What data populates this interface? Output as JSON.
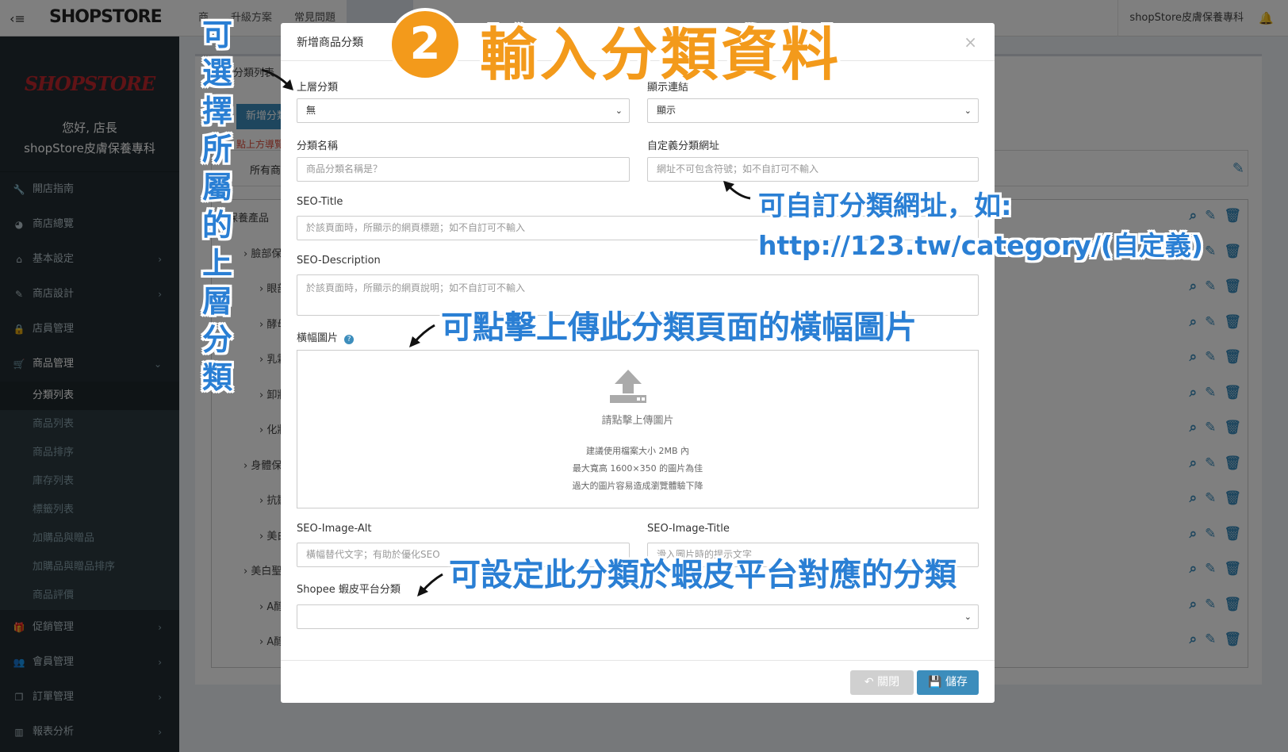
{
  "topbar": {
    "logo": "SHOPSTORE",
    "nav": [
      "商",
      "升級方案",
      "常見問題"
    ],
    "store_name": "shopStore皮膚保養專科"
  },
  "sidebar": {
    "brand": "SHOPSTORE",
    "hello": "您好, 店長",
    "store": "shopStore皮膚保養專科",
    "menu": [
      {
        "label": "開店指南",
        "icon": "wrench-icon"
      },
      {
        "label": "商店總覽",
        "icon": "dashboard-icon"
      },
      {
        "label": "基本設定",
        "icon": "bank-icon"
      },
      {
        "label": "商店設計",
        "icon": "magic-icon"
      },
      {
        "label": "店員管理",
        "icon": "lock-icon"
      },
      {
        "label": "商品管理",
        "icon": "cart-icon"
      }
    ],
    "submenu": [
      "分類列表",
      "商品列表",
      "商品排序",
      "庫存列表",
      "標籤列表",
      "加購品與贈品",
      "加購品與贈品排序",
      "商品評價"
    ],
    "menu2": [
      {
        "label": "促銷管理",
        "icon": "gift-icon"
      },
      {
        "label": "會員管理",
        "icon": "users-icon"
      },
      {
        "label": "訂單管理",
        "icon": "copy-icon"
      },
      {
        "label": "報表分析",
        "icon": "chart-icon"
      }
    ]
  },
  "content": {
    "title": "分類列表",
    "add_btn": "新增分類",
    "tip": "點上方導覽",
    "all_products": "所有商品",
    "rows": [
      "保養產品",
      "臉部保養",
      "眼部保",
      "酵母淨",
      "乳霜",
      "卸妝水",
      "化妝水",
      "身體保養",
      "抗皺身",
      "美白乳",
      "美白聖品",
      "A醇精",
      "A醇面"
    ]
  },
  "modal": {
    "title": "新增商品分類",
    "parent_label": "上層分類",
    "parent_value": "無",
    "display_label": "顯示連結",
    "display_value": "顯示",
    "name_label": "分類名稱",
    "name_placeholder": "商品分類名稱是？",
    "url_label": "自定義分類網址",
    "url_placeholder": "網址不可包含符號；如不自訂可不輸入",
    "seo_title_label": "SEO-Title",
    "seo_title_placeholder": "於該頁面時，所顯示的網頁標題；如不自訂可不輸入",
    "seo_desc_label": "SEO-Description",
    "seo_desc_placeholder": "於該頁面時，所顯示的網頁說明；如不自訂可不輸入",
    "banner_label": "橫幅圖片",
    "upload_text": "請點擊上傳圖片",
    "upload_note1": "建議使用檔案大小 2MB 內",
    "upload_note2": "最大寬高 1600×350 的圖片為佳",
    "upload_note3": "過大的圖片容易造成瀏覽體驗下降",
    "alt_label": "SEO-Image-Alt",
    "alt_placeholder": "橫幅替代文字；有助於優化SEO",
    "imgtitle_label": "SEO-Image-Title",
    "imgtitle_placeholder": "滑入圖片時的提示文字",
    "shopee_label": "Shopee 蝦皮平台分類",
    "close_btn": "關閉",
    "save_btn": "儲存"
  },
  "annotations": {
    "step_number": "2",
    "step_title": "輸入分類資料",
    "parent_note": "可選擇所屬的上層分類",
    "url_note1": "可自訂分類網址，如:",
    "url_note2": "http://123.tw/category/(自定義)",
    "banner_note": "可點擊上傳此分類頁面的橫幅圖片",
    "shopee_note": "可設定此分類於蝦皮平台對應的分類"
  },
  "colors": {
    "accent": "#3c8dbc",
    "annotation_blue": "#2a7fd4",
    "annotation_orange": "#f39a1b",
    "sidebar_bg": "#222d32"
  }
}
